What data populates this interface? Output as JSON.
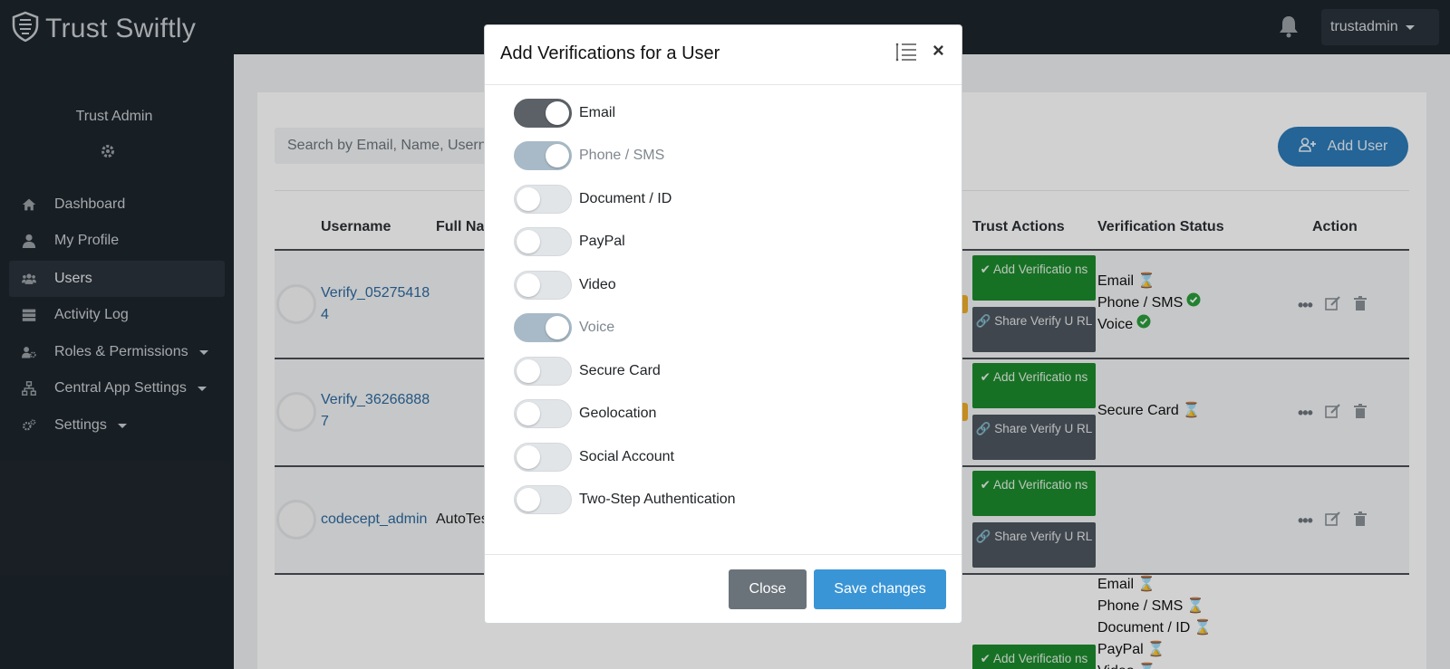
{
  "app": {
    "brand": "Trust Swiftly",
    "user_menu": "trustadmin"
  },
  "sidebar": {
    "account_name": "Trust Admin",
    "items": [
      {
        "label": "Dashboard",
        "icon": "home-icon"
      },
      {
        "label": "My Profile",
        "icon": "user-icon"
      },
      {
        "label": "Users",
        "icon": "users-icon",
        "active": true
      },
      {
        "label": "Activity Log",
        "icon": "database-icon"
      },
      {
        "label": "Roles & Permissions",
        "icon": "user-gear-icon",
        "dropdown": true
      },
      {
        "label": "Central App Settings",
        "icon": "network-icon",
        "dropdown": true
      },
      {
        "label": "Settings",
        "icon": "gears-icon",
        "dropdown": true
      }
    ]
  },
  "main": {
    "search_placeholder": "Search by Email, Name, Username",
    "add_user_label": "Add User",
    "columns": [
      "Username",
      "Full Na",
      "Trust Actions",
      "Verification Status",
      "Action"
    ],
    "trust_actions": {
      "add": "Add Verificatio ns",
      "share": "Share Verify U RL"
    },
    "rows": [
      {
        "username": "Verify_05275418 4",
        "full_name": "",
        "statuses": [
          {
            "label": "Email",
            "state": "pending"
          },
          {
            "label": "Phone / SMS",
            "state": "verified"
          },
          {
            "label": "Voice",
            "state": "verified"
          }
        ]
      },
      {
        "username": "Verify_36266888 7",
        "full_name": "",
        "statuses": [
          {
            "label": "Secure Card",
            "state": "pending"
          }
        ]
      },
      {
        "username": "codecept_admin",
        "full_name": "AutoTes",
        "statuses": []
      },
      {
        "username": "",
        "full_name": "",
        "statuses": [
          {
            "label": "Email",
            "state": "pending"
          },
          {
            "label": "Phone / SMS",
            "state": "pending"
          },
          {
            "label": "Document / ID",
            "state": "pending"
          },
          {
            "label": "PayPal",
            "state": "pending"
          },
          {
            "label": "Video",
            "state": "pending"
          }
        ]
      }
    ]
  },
  "modal": {
    "title": "Add Verifications for a User",
    "toggles": [
      {
        "label": "Email",
        "state": "on"
      },
      {
        "label": "Phone / SMS",
        "state": "on-disabled"
      },
      {
        "label": "Document / ID",
        "state": "off"
      },
      {
        "label": "PayPal",
        "state": "off"
      },
      {
        "label": "Video",
        "state": "off"
      },
      {
        "label": "Voice",
        "state": "on-disabled"
      },
      {
        "label": "Secure Card",
        "state": "off"
      },
      {
        "label": "Geolocation",
        "state": "off"
      },
      {
        "label": "Social Account",
        "state": "off"
      },
      {
        "label": "Two-Step Authentication",
        "state": "off"
      }
    ],
    "close_label": "Close",
    "save_label": "Save changes"
  },
  "colors": {
    "accent_blue": "#2c7ab8",
    "success_green": "#1d8a2c",
    "pending_orange": "#e0961c",
    "sidebar_bg": "#1e262d"
  }
}
